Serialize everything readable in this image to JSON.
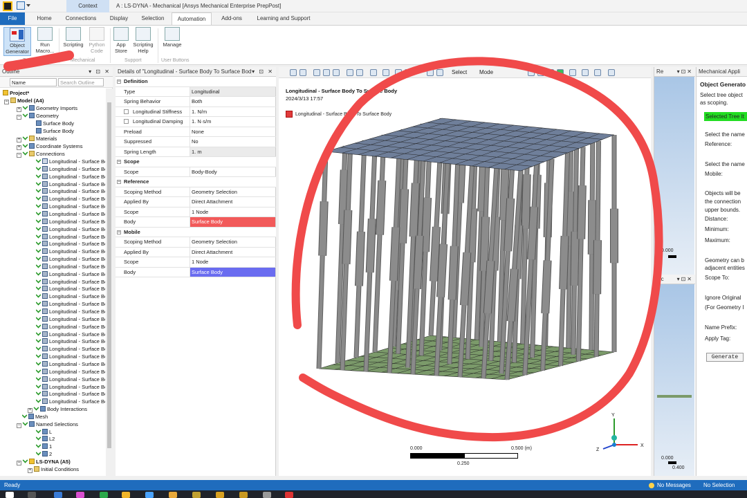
{
  "window": {
    "title": "A : LS-DYNA - Mechanical [Ansys Mechanical Enterprise PrepPost]",
    "context_tab": "Context"
  },
  "ribbon": {
    "tabs": [
      "File",
      "Home",
      "Connections",
      "Display",
      "Selection",
      "Automation",
      "Add-ons",
      "Learning and Support"
    ],
    "active_tab": "Automation",
    "buttons": {
      "object_generator": "Object\nGenerator",
      "run_macro": "Run\nMacro...",
      "scripting": "Scripting",
      "python_code": "Python\nCode",
      "app_store": "App\nStore",
      "scripting_help": "Scripting\nHelp",
      "manage": "Manage"
    },
    "groups": {
      "tools": "Tools",
      "mechanical": "Mechanical",
      "support": "Support",
      "user_buttons": "User Buttons"
    }
  },
  "outline": {
    "title": "Outline",
    "name_filter": "Name",
    "search_placeholder": "Search Outline",
    "tree": {
      "project": "Project*",
      "model": "Model (A4)",
      "geometry_imports": "Geometry Imports",
      "geometry": "Geometry",
      "surface_body_1": "Surface Body",
      "surface_body_2": "Surface Body",
      "materials": "Materials",
      "coordinate_systems": "Coordinate Systems",
      "connections": "Connections",
      "spring_item": "Longitudinal - Surface Body To Surface Body",
      "spring_count": 33,
      "body_interactions": "Body Interactions",
      "mesh": "Mesh",
      "named_selections": "Named Selections",
      "ns_items": [
        "L",
        "L2",
        "1",
        "2"
      ],
      "ls_dyna": "LS-DYNA (A5)",
      "initial_conditions": "Initial Conditions"
    }
  },
  "details": {
    "title": "Details of \"Longitudinal - Surface Body To Surface Body\"",
    "sections": {
      "definition": "Definition",
      "scope": "Scope",
      "reference": "Reference",
      "mobile": "Mobile"
    },
    "rows": {
      "type": [
        "Type",
        "Longitudinal"
      ],
      "spring_behavior": [
        "Spring Behavior",
        "Both"
      ],
      "stiffness": [
        "Longitudinal Stiffness",
        "1. N/m"
      ],
      "damping": [
        "Longitudinal Damping",
        "1. N·s/m"
      ],
      "preload": [
        "Preload",
        "None"
      ],
      "suppressed": [
        "Suppressed",
        "No"
      ],
      "spring_length": [
        "Spring Length",
        "1. m"
      ],
      "scope_scope": [
        "Scope",
        "Body-Body"
      ],
      "ref_method": [
        "Scoping Method",
        "Geometry Selection"
      ],
      "ref_applied": [
        "Applied By",
        "Direct Attachment"
      ],
      "ref_scope": [
        "Scope",
        "1 Node"
      ],
      "ref_body": [
        "Body",
        "Surface Body"
      ],
      "mob_method": [
        "Scoping Method",
        "Geometry Selection"
      ],
      "mob_applied": [
        "Applied By",
        "Direct Attachment"
      ],
      "mob_scope": [
        "Scope",
        "1 Node"
      ],
      "mob_body": [
        "Body",
        "Surface Body"
      ]
    },
    "colors": {
      "reference_body": "#f25a5a",
      "mobile_body": "#6a6cf0"
    }
  },
  "graphics": {
    "label_title": "Longitudinal - Surface Body To Surface Body",
    "label_date": "2024/3/13 17:57",
    "legend": "Longitudinal - Surface Body To Surface Body",
    "select_label": "Select",
    "mode_label": "Mode",
    "scale": {
      "left": "0.000",
      "right": "0.500 (m)",
      "mid": "0.250"
    },
    "triad": {
      "x": "X",
      "y": "Y",
      "z": "Z"
    },
    "plate_top_color": "#6f7f9a",
    "plate_bottom_color": "#7b9a6a",
    "rod_color": "#8a8a8a"
  },
  "right_panels": {
    "p1_title": "Re",
    "p2_title": "Mc",
    "p1_scale": "0.000",
    "p2_scale_a": "0.000",
    "p2_scale_b": "0.400"
  },
  "mech_app": {
    "title": "Mechanical Appli",
    "heading": "Object Generato",
    "line1": "Select tree object",
    "line2": "as scoping.",
    "selected": "Selected Tree It",
    "ref_select": "Select the name",
    "ref_label": "Reference:",
    "mob_select": "Select the name",
    "mob_label": "Mobile:",
    "obj_will": "Objects will be",
    "conn_text": "the connection",
    "upper": "upper bounds.",
    "distance": "Distance:",
    "minimum": "Minimum:",
    "maximum": "Maximum:",
    "geom_can": "Geometry can b",
    "adjacent": "adjacent entities",
    "scope_to": "Scope To:",
    "ignore": "Ignore Original",
    "for_geom": "(For Geometry I",
    "name_prefix": "Name Prefix:",
    "apply_tag": "Apply Tag:",
    "generate": "Generate",
    "selected_color": "#22dd22"
  },
  "status": {
    "ready": "Ready",
    "messages": "No Messages",
    "selection": "No Selection"
  },
  "annotation_color": "#f04a4a"
}
